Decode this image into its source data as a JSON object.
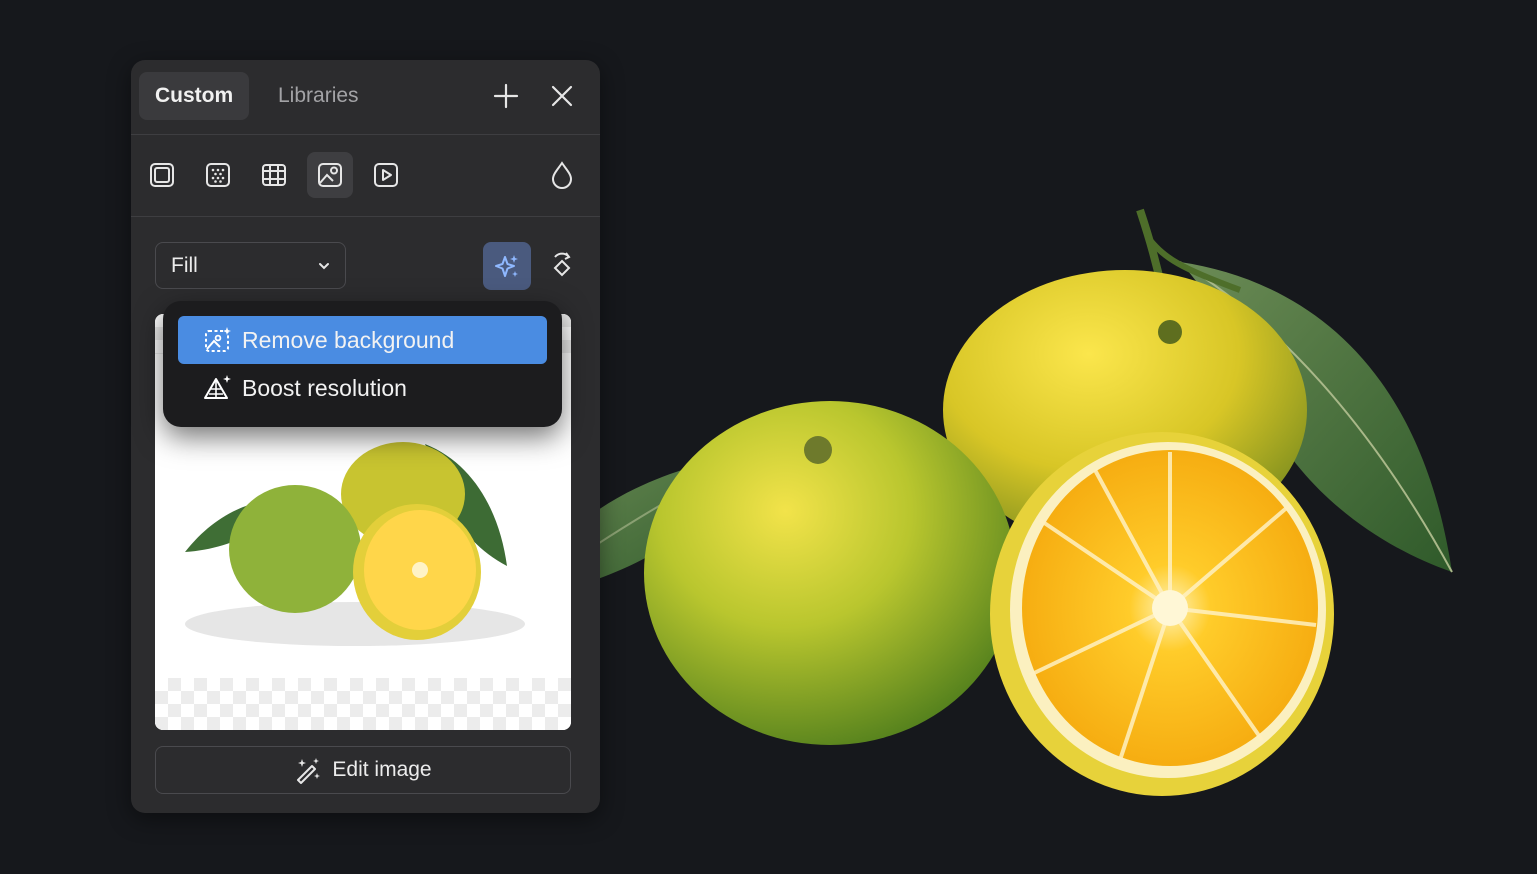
{
  "tabs": {
    "custom_label": "Custom",
    "libraries_label": "Libraries"
  },
  "toolbar": {
    "icons": [
      "solid-fill-icon",
      "noise-fill-icon",
      "pattern-fill-icon",
      "image-fill-icon",
      "video-fill-icon",
      "opacity-drop-icon"
    ],
    "selected_icon": "image-fill-icon"
  },
  "fill_mode": {
    "selected": "Fill"
  },
  "menu": {
    "items": [
      {
        "label": "Remove background",
        "icon": "remove-background-icon",
        "highlighted": true
      },
      {
        "label": "Boost resolution",
        "icon": "boost-resolution-icon",
        "highlighted": false
      }
    ]
  },
  "edit_image_label": "Edit image",
  "colors": {
    "background": "#16181c",
    "panel": "#2c2c2e",
    "menu": "#1c1c1e",
    "highlight": "#4a8ce2",
    "ai_button": "#4a5a7e"
  }
}
